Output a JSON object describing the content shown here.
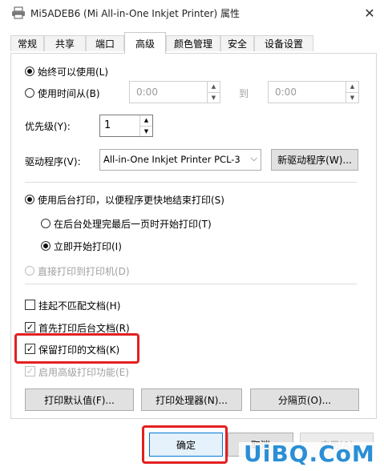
{
  "window": {
    "title": "Mi5ADEB6 (Mi All-in-One Inkjet Printer) 属性",
    "close_glyph": "✕"
  },
  "tabs": [
    {
      "label": "常规"
    },
    {
      "label": "共享"
    },
    {
      "label": "端口"
    },
    {
      "label": "高级",
      "active": true
    },
    {
      "label": "颜色管理"
    },
    {
      "label": "安全"
    },
    {
      "label": "设备设置"
    }
  ],
  "availability": {
    "always_label": "始终可以使用(L)",
    "from_label": "使用时间从(B)",
    "from_value": "0:00",
    "to_label": "到",
    "to_value": "0:00",
    "selected": "always"
  },
  "priority": {
    "label": "优先级(Y):",
    "value": "1"
  },
  "driver": {
    "label": "驱动程序(V):",
    "value": "All-in-One Inkjet Printer PCL-3",
    "new_driver_button": "新驱动程序(W)..."
  },
  "spooling": {
    "spool_label": "使用后台打印，以便程序更快地结束打印(S)",
    "after_last_page_label": "在后台处理完最后一页时开始打印(T)",
    "immediately_label": "立即开始打印(I)",
    "direct_label": "直接打印到打印机(D)"
  },
  "options": {
    "hold_mismatched_label": "挂起不匹配文档(H)",
    "hold_mismatched_checked": false,
    "spooled_first_label": "首先打印后台文档(R)",
    "spooled_first_checked": true,
    "keep_printed_label": "保留打印的文档(K)",
    "keep_printed_checked": true,
    "advanced_features_label": "启用高级打印功能(E)",
    "advanced_features_checked": true
  },
  "bottom_buttons": {
    "defaults": "打印默认值(F)...",
    "processor": "打印处理器(N)...",
    "separator": "分隔页(O)..."
  },
  "dialog_buttons": {
    "ok": "确定",
    "cancel": "取消",
    "apply": "应用(A)"
  },
  "watermark": {
    "text": "UiBQ.CoM"
  },
  "colors": {
    "highlight": "#e32020",
    "watermark": "#2a8fd6"
  },
  "icons": {
    "title": "printer-icon",
    "close": "close-icon",
    "spin_up": "chevron-up-icon",
    "spin_down": "chevron-down-icon",
    "dropdown": "chevron-down-icon"
  }
}
